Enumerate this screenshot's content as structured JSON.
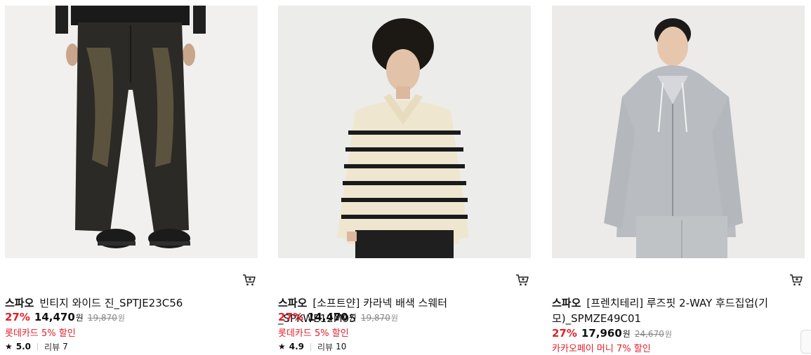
{
  "products": [
    {
      "brand": "스파오",
      "name": "빈티지 와이드 진_SPTJE23C56",
      "discount": "27%",
      "price": "14,470",
      "currency": "원",
      "original_price": "19,870",
      "original_currency": "원",
      "promo": "롯데카드 5% 할인",
      "rating": "5.0",
      "review_label": "리뷰",
      "review_count": "7",
      "image": "wide-vintage-jeans-photo"
    },
    {
      "brand": "스파오",
      "name": "[소프트얀] 카라넥 배색 스웨터_SPKWE12M95",
      "discount": "27%",
      "price": "14,470",
      "currency": "원",
      "original_price": "19,870",
      "original_currency": "원",
      "promo": "롯데카드 5% 할인",
      "rating": "4.9",
      "review_label": "리뷰",
      "review_count": "10",
      "image": "striped-collar-sweater-photo"
    },
    {
      "brand": "스파오",
      "name": "[프렌치테리] 루즈핏 2-WAY 후드집업(기모)_SPMZE49C01",
      "discount": "27%",
      "price": "17,960",
      "currency": "원",
      "original_price": "24,670",
      "original_currency": "원",
      "promo": "카카오페이 머니 7% 할인",
      "image": "grey-hood-zipup-photo"
    }
  ],
  "icons": {
    "cart": "cart-icon",
    "star": "star-icon"
  },
  "colors": {
    "discount": "#e0202a",
    "promo": "#e0202a",
    "text": "#111111",
    "strikethrough": "#888888"
  }
}
